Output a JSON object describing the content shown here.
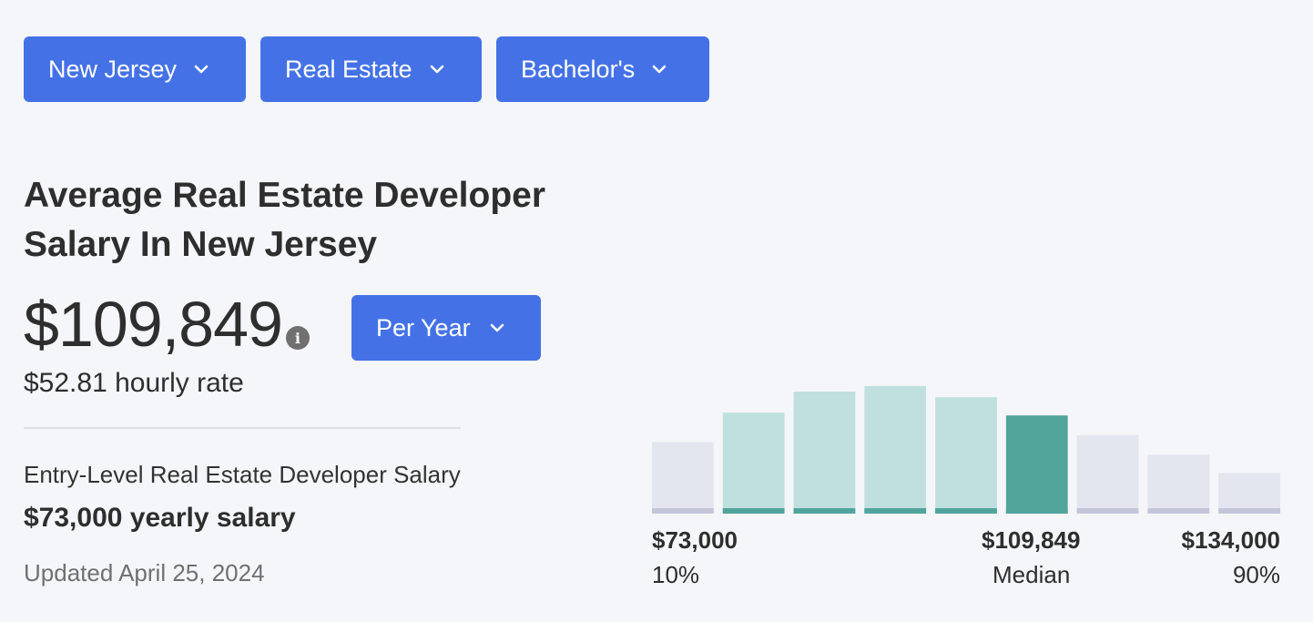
{
  "filters": {
    "state": "New Jersey",
    "industry": "Real Estate",
    "degree": "Bachelor's"
  },
  "heading": "Average Real Estate Developer Salary In New Jersey",
  "salary": {
    "amount": "$109,849",
    "info_icon_glyph": "i",
    "period": "Per Year",
    "hourly": "$52.81 hourly rate"
  },
  "entry_level": {
    "label": "Entry-Level Real Estate Developer Salary",
    "value": "$73,000 yearly salary"
  },
  "updated": "Updated April 25, 2024",
  "colors": {
    "accent": "#4472e6",
    "bar_outside": "#e3e6ef",
    "bar_outside_base": "#c3c6d8",
    "bar_inside": "#c0dfdf",
    "bar_inside_base": "#52a59b",
    "bar_median": "#52a59b"
  },
  "chart_data": {
    "type": "bar",
    "relative_heights": [
      0.51,
      0.72,
      0.87,
      0.91,
      0.83,
      0.7,
      0.56,
      0.42,
      0.29
    ],
    "bar_roles": [
      "outside",
      "inside",
      "inside",
      "inside",
      "inside",
      "median",
      "outside",
      "outside",
      "outside"
    ],
    "markers": [
      {
        "value": "$73,000",
        "label": "10%"
      },
      {
        "value": "$109,849",
        "label": "Median"
      },
      {
        "value": "$134,000",
        "label": "90%"
      }
    ]
  }
}
